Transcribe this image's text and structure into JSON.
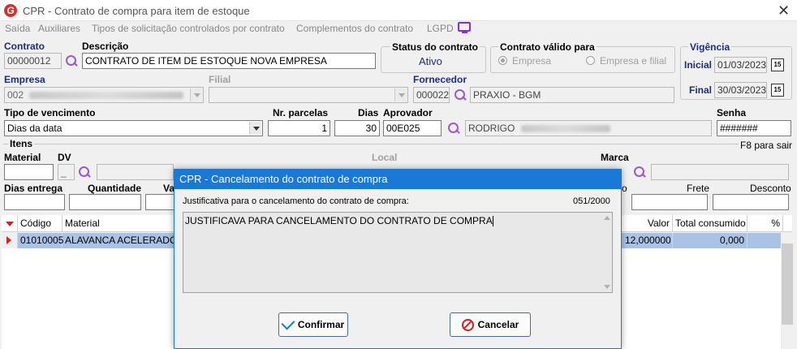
{
  "window": {
    "title": "CPR - Contrato de compra para item de estoque",
    "close_label": "✕"
  },
  "menu": [
    "Saída",
    "Auxiliares",
    "Tipos de solicitação controlados por contrato",
    "Complementos do contrato",
    "LGPD"
  ],
  "contrato": {
    "label": "Contrato",
    "value": "00000012"
  },
  "descricao": {
    "label": "Descrição",
    "value": "CONTRATO DE ITEM DE ESTOQUE NOVA EMPRESA"
  },
  "status": {
    "label": "Status do contrato",
    "value": "Ativo"
  },
  "valido_para": {
    "label": "Contrato válido para",
    "opt1": "Empresa",
    "opt2": "Empresa e filial"
  },
  "vigencia": {
    "label": "Vigência",
    "inicial_label": "Inicial",
    "inicial": "01/03/2023",
    "final_label": "Final",
    "final": "30/03/2023",
    "cal_glyph": "15"
  },
  "empresa": {
    "label": "Empresa",
    "value": "002"
  },
  "filial": {
    "label": "Filial"
  },
  "fornecedor": {
    "label": "Fornecedor",
    "code": "000022",
    "name": "PRAXIO - BGM"
  },
  "vencimento": {
    "label": "Tipo de vencimento",
    "value": "Dias da data"
  },
  "parcelas": {
    "label": "Nr. parcelas",
    "value": "1"
  },
  "dias": {
    "label": "Dias",
    "value": "30"
  },
  "aprovador": {
    "label": "Aprovador",
    "code": "00E025",
    "name": "RODRIGO"
  },
  "senha": {
    "label": "Senha",
    "value": "#######"
  },
  "itens": {
    "label": "Itens",
    "hint": "F8 para sair",
    "material_label": "Material",
    "dv_label": "DV",
    "dv_value": "_",
    "local_label": "Local",
    "marca_label": "Marca",
    "dias_entrega_label": "Dias entrega",
    "quantidade_label": "Quantidade",
    "va_label": "Va",
    "o_label": "o",
    "frete_label": "Frete",
    "desconto_label": "Desconto"
  },
  "grid": {
    "headers": {
      "codigo": "Código",
      "material": "Material",
      "valor": "Valor",
      "total": "Total consumido",
      "pct": "%"
    },
    "row": {
      "codigo": "01010005",
      "material": "ALAVANCA ACELERADOR U",
      "valor": "12,000000",
      "total": "0,000"
    }
  },
  "dialog": {
    "title": "CPR - Cancelamento do contrato de compra",
    "prompt": "Justificativa para o cancelamento do contrato de compra:",
    "counter": "051/2000",
    "text": "JUSTIFICAVA PARA CANCELAMENTO DO CONTRATO DE COMPRA",
    "confirm": "Confirmar",
    "cancel": "Cancelar"
  }
}
